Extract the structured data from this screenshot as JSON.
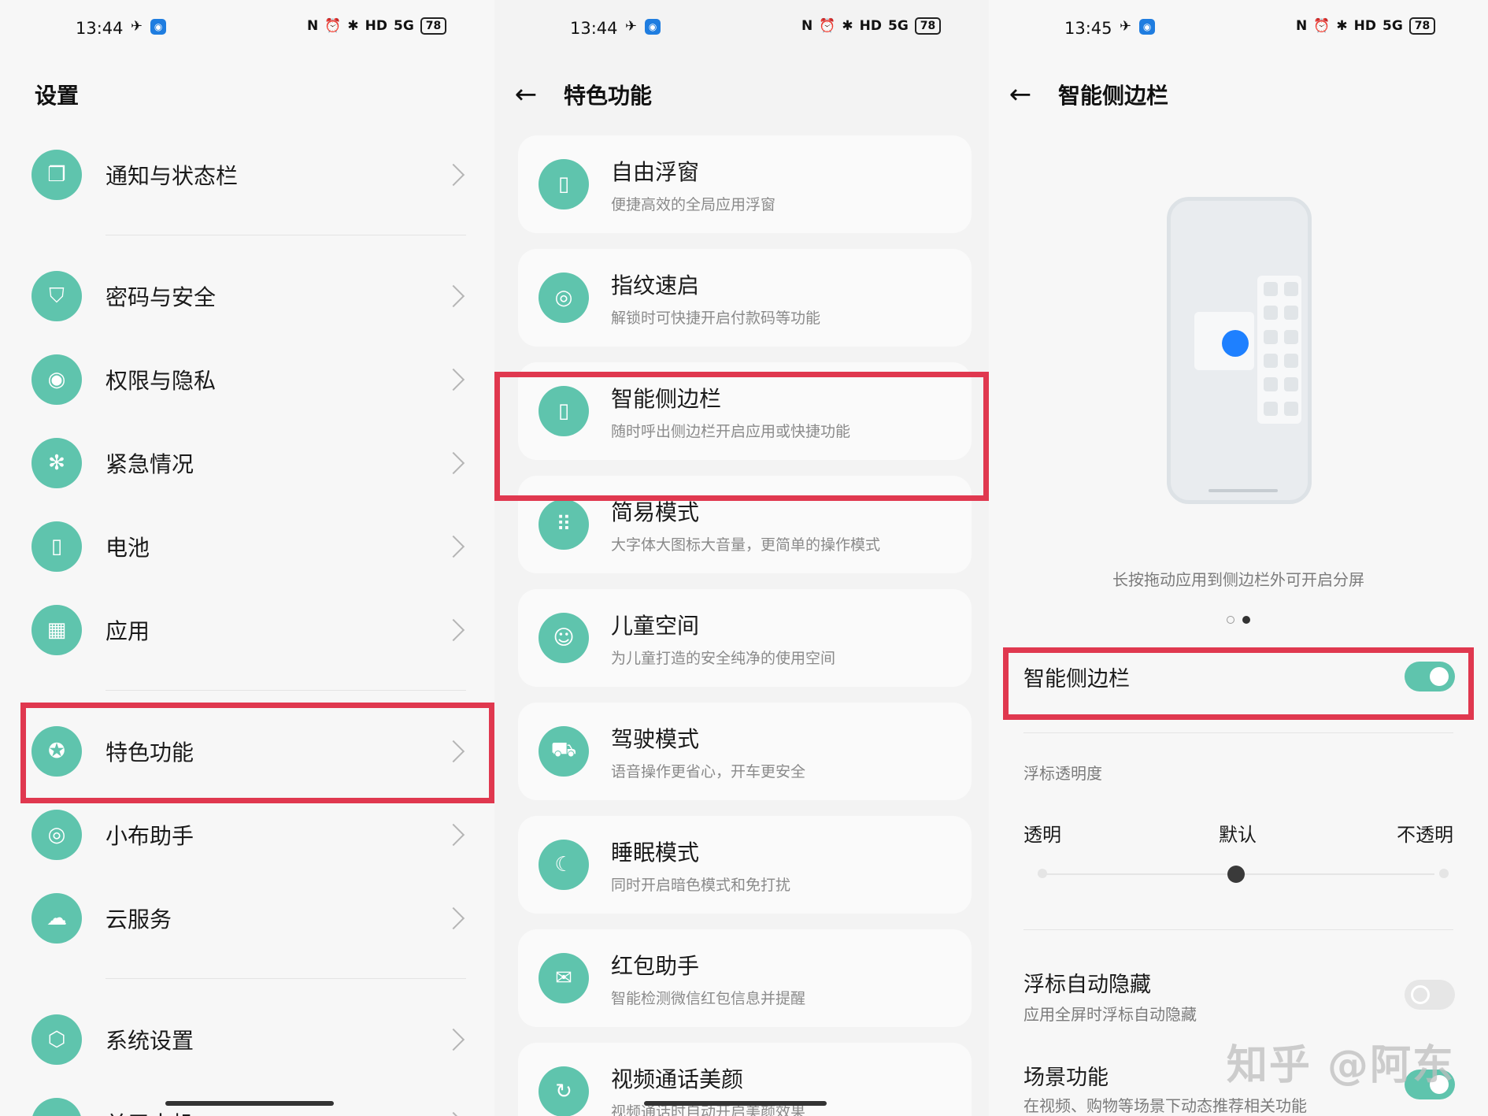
{
  "status": [
    {
      "time": "13:44",
      "battery": "78",
      "network": "5G"
    },
    {
      "time": "13:44",
      "battery": "78",
      "network": "5G"
    },
    {
      "time": "13:45",
      "battery": "78",
      "network": "5G"
    }
  ],
  "settings": {
    "title": "设置",
    "items": [
      {
        "label": "通知与状态栏",
        "icon": "notification-icon"
      },
      {
        "label": "密码与安全",
        "icon": "shield-icon"
      },
      {
        "label": "权限与隐私",
        "icon": "eye-icon"
      },
      {
        "label": "紧急情况",
        "icon": "asterisk-icon"
      },
      {
        "label": "电池",
        "icon": "battery-icon"
      },
      {
        "label": "应用",
        "icon": "apps-grid-icon"
      },
      {
        "label": "特色功能",
        "icon": "star-icon"
      },
      {
        "label": "小布助手",
        "icon": "assistant-icon"
      },
      {
        "label": "云服务",
        "icon": "cloud-icon"
      },
      {
        "label": "系统设置",
        "icon": "gear-icon"
      },
      {
        "label": "关于本机",
        "icon": "phone-icon"
      }
    ]
  },
  "features": {
    "title": "特色功能",
    "items": [
      {
        "title": "自由浮窗",
        "sub": "便捷高效的全局应用浮窗",
        "icon": "window-icon"
      },
      {
        "title": "指纹速启",
        "sub": "解锁时可快捷开启付款码等功能",
        "icon": "fingerprint-icon"
      },
      {
        "title": "智能侧边栏",
        "sub": "随时呼出侧边栏开启应用或快捷功能",
        "icon": "sidebar-icon"
      },
      {
        "title": "简易模式",
        "sub": "大字体大图标大音量，更简单的操作模式",
        "icon": "dots-grid-icon"
      },
      {
        "title": "儿童空间",
        "sub": "为儿童打造的安全纯净的使用空间",
        "icon": "child-face-icon"
      },
      {
        "title": "驾驶模式",
        "sub": "语音操作更省心，开车更安全",
        "icon": "car-icon"
      },
      {
        "title": "睡眠模式",
        "sub": "同时开启暗色模式和免打扰",
        "icon": "moon-icon"
      },
      {
        "title": "红包助手",
        "sub": "智能检测微信红包信息并提醒",
        "icon": "envelope-icon"
      },
      {
        "title": "视频通话美颜",
        "sub": "视频通话时自动开启美颜效果",
        "icon": "beauty-icon"
      }
    ]
  },
  "sidebar": {
    "title": "智能侧边栏",
    "caption": "长按拖动应用到侧边栏外可开启分屏",
    "main_toggle_label": "智能侧边栏",
    "main_toggle_on": true,
    "opacity_title": "浮标透明度",
    "opacity_levels": [
      "透明",
      "默认",
      "不透明"
    ],
    "opacity_value": 0.5,
    "auto_hide_title": "浮标自动隐藏",
    "auto_hide_sub": "应用全屏时浮标自动隐藏",
    "auto_hide_on": false,
    "scene_title": "场景功能",
    "scene_sub": "在视频、购物等场景下动态推荐相关功能",
    "scene_on": true
  },
  "watermark": "知乎 @阿东",
  "colors": {
    "accent": "#5fc4ad",
    "highlight": "#e0384f",
    "float_ball": "#1e80ff"
  }
}
